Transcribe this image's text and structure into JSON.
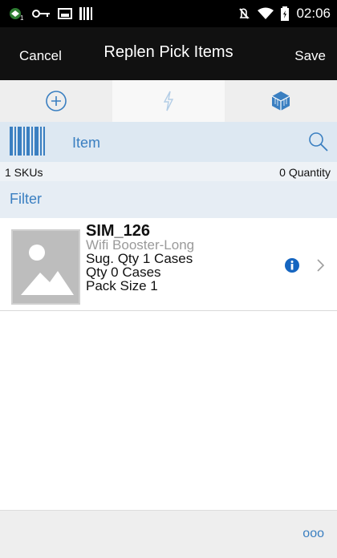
{
  "status_bar": {
    "time": "02:06",
    "icons_left": [
      "mail-icon",
      "key-icon",
      "image-icon",
      "barcode-icon"
    ],
    "icons_right": [
      "mute-icon",
      "wifi-icon",
      "battery-icon"
    ]
  },
  "header": {
    "cancel_label": "Cancel",
    "title": "Replen Pick Items",
    "save_label": "Save"
  },
  "tabs": [
    {
      "icon": "plus-circle-icon",
      "active": false
    },
    {
      "icon": "lightning-icon",
      "active": true
    },
    {
      "icon": "cube-icon",
      "active": false
    }
  ],
  "scan": {
    "label": "Item"
  },
  "counts": {
    "skus": "1 SKUs",
    "quantity": "0 Quantity"
  },
  "filter": {
    "label": "Filter"
  },
  "items": [
    {
      "id": "SIM_126",
      "description": "Wifi Booster-Long",
      "suggested_qty": "Sug. Qty  1  Cases",
      "qty": "Qty  0  Cases",
      "pack_size": "Pack Size  1"
    }
  ],
  "bottom": {
    "more_label": "ooo"
  },
  "colors": {
    "accent": "#3a7fc1",
    "header_bg": "#111111",
    "info_blue": "#1565c0"
  }
}
